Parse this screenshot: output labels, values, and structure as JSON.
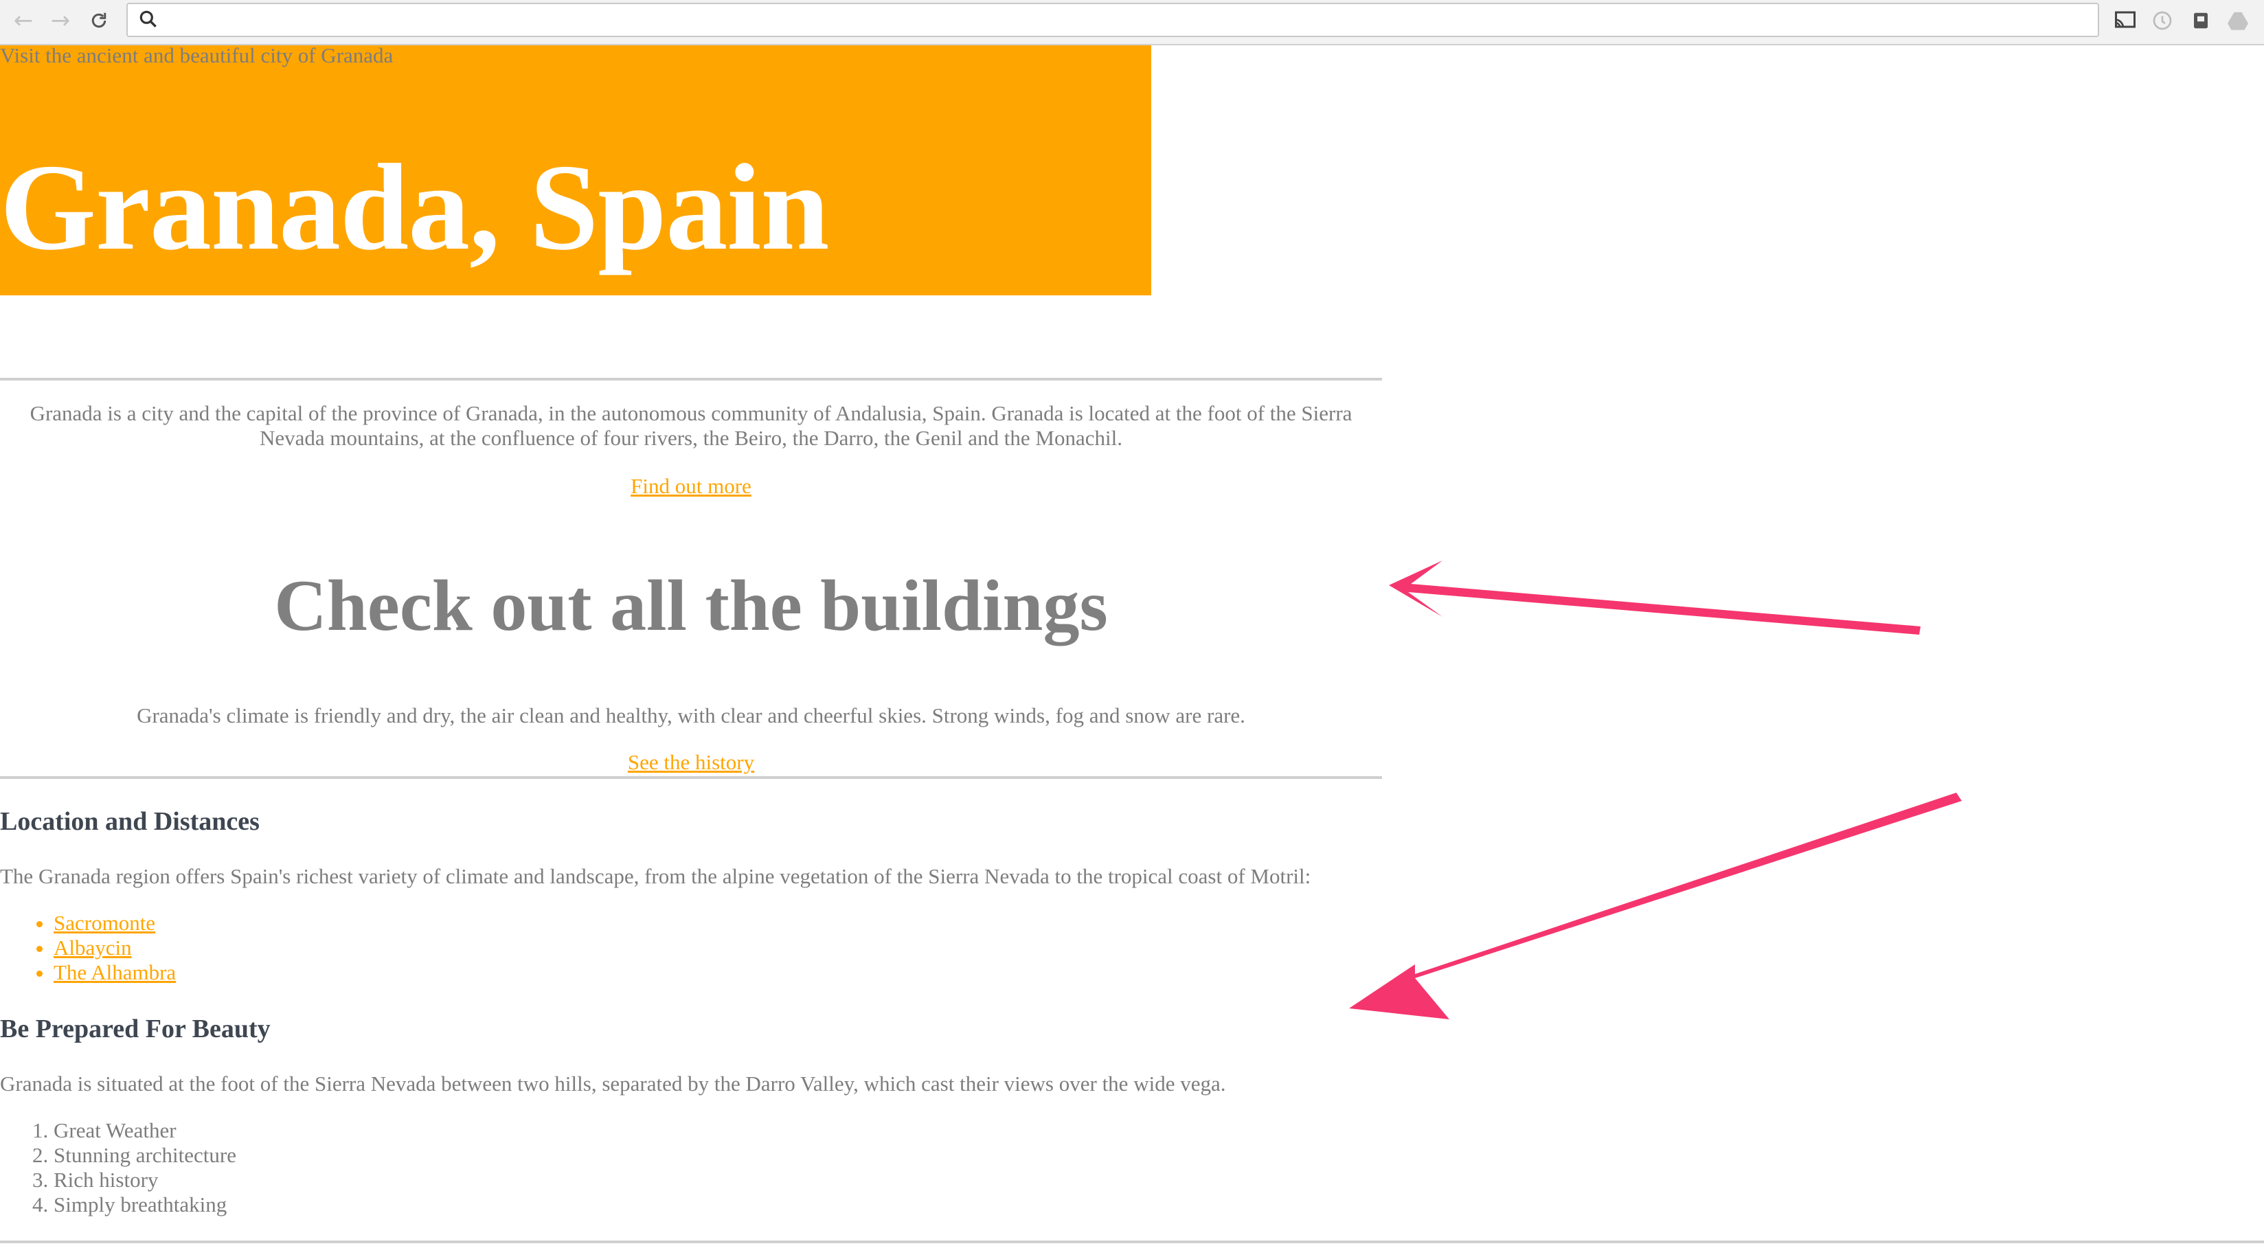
{
  "browser": {
    "address_value": "",
    "colors": {
      "chrome_bg": "#f2f2f2",
      "annotation_arrow": "#f5356e"
    },
    "icons": [
      "back-arrow-icon",
      "forward-arrow-icon",
      "reload-icon",
      "search-icon",
      "cast-icon",
      "extension-icon",
      "extension-icon-2",
      "drive-icon"
    ]
  },
  "hero": {
    "tagline": "Visit the ancient and beautiful city of Granada",
    "title": "Granada, Spain",
    "bg_color": "#ffa500"
  },
  "intro": {
    "text": "Granada is a city and the capital of the province of Granada, in the autonomous community of Andalusia, Spain. Granada is located at the foot of the Sierra Nevada mountains, at the confluence of four rivers, the Beiro, the Darro, the Genil and the Monachil.",
    "link_label": "Find out more"
  },
  "buildings": {
    "heading": "Check out all the buildings",
    "text": "Granada's climate is friendly and dry, the air clean and healthy, with clear and cheerful skies. Strong winds, fog and snow are rare.",
    "link_label": "See the history"
  },
  "location": {
    "heading": "Location and Distances",
    "text": "The Granada region offers Spain's richest variety of climate and landscape, from the alpine vegetation of the Sierra Nevada to the tropical coast of Motril:",
    "places": [
      "Sacromonte",
      "Albaycin",
      "The Alhambra"
    ]
  },
  "beauty": {
    "heading": "Be Prepared For Beauty",
    "text": "Granada is situated at the foot of the Sierra Nevada between two hills, separated by the Darro Valley, which cast their views over the wide vega.",
    "reasons": [
      "Great Weather",
      "Stunning architecture",
      "Rich history",
      "Simply breathtaking"
    ]
  }
}
